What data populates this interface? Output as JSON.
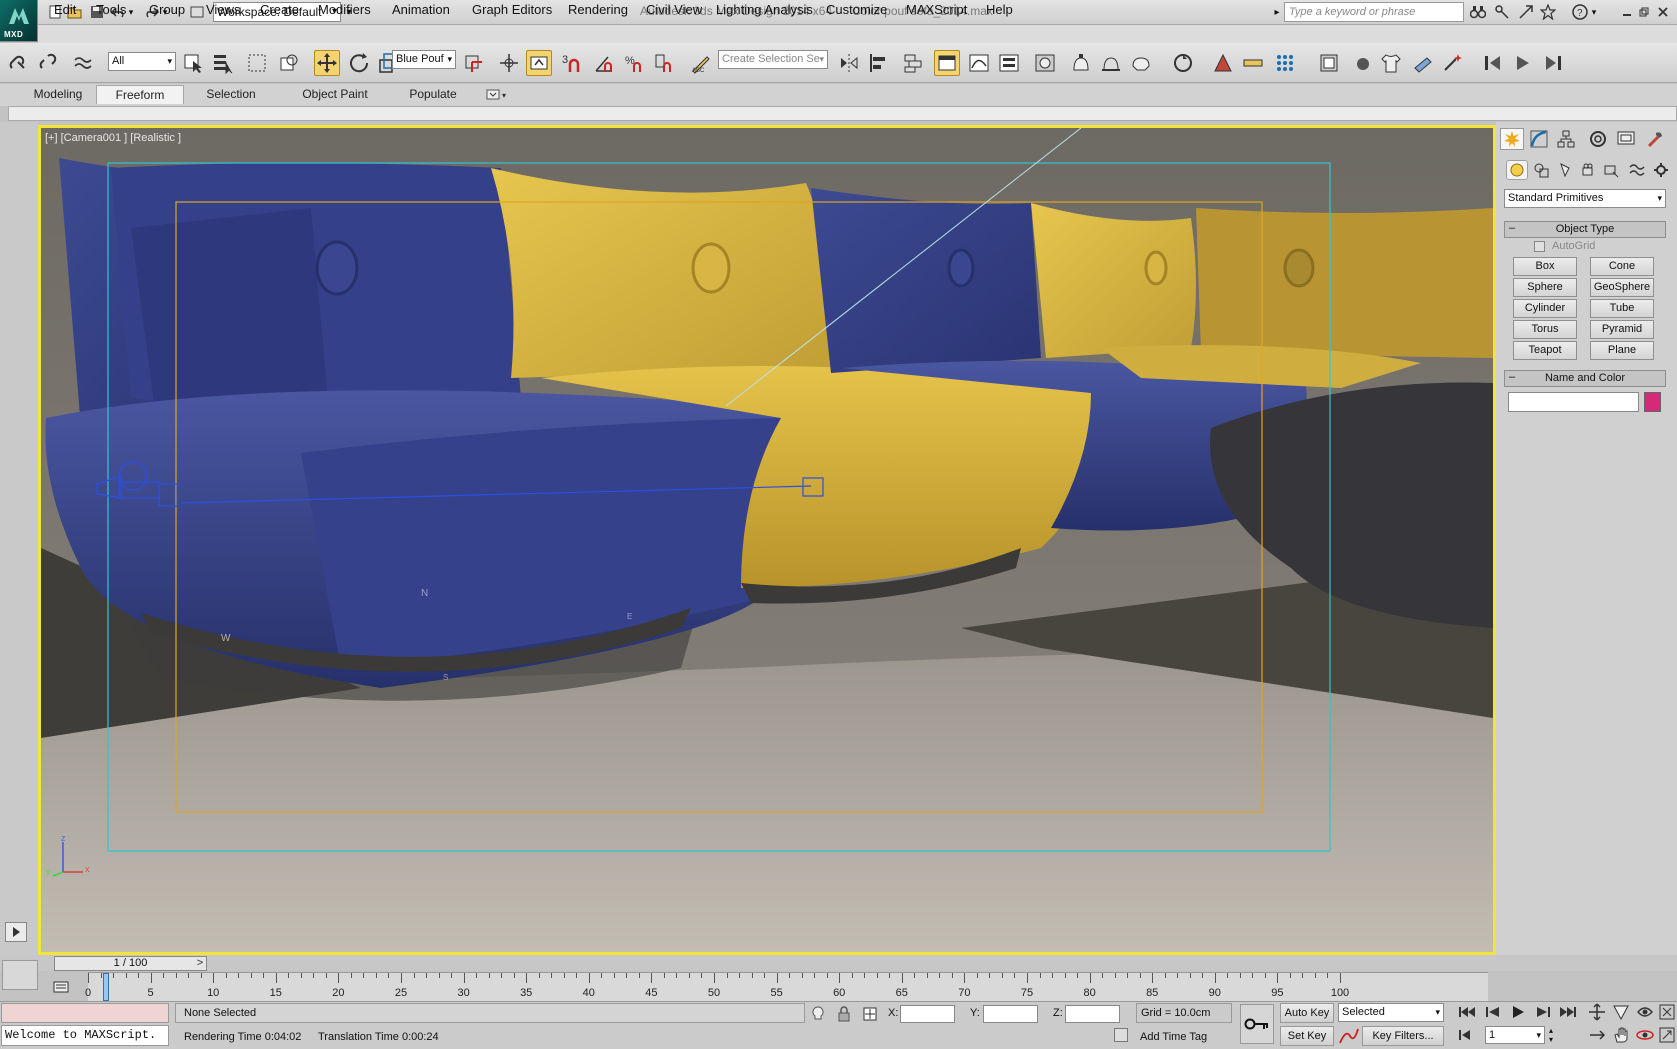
{
  "app": {
    "title": "Autodesk 3ds Max Design 2014 x64",
    "file": "Color pouf sofa_2014.max",
    "logo_text": "MXD",
    "workspace": "Workspace: Default",
    "search_placeholder": "Type a keyword or phrase"
  },
  "menu": [
    "Edit",
    "Tools",
    "Group",
    "Views",
    "Create",
    "Modifiers",
    "Animation",
    "Graph Editors",
    "Rendering",
    "Civil View",
    "Lighting Analysis",
    "Customize",
    "MAXScript",
    "Help"
  ],
  "toolbar": {
    "selection_filter": "All",
    "layer": "Blue Pouf",
    "named_selection_placeholder": "Create Selection Se",
    "snap_3": "3"
  },
  "ribbon": {
    "tabs": [
      "Modeling",
      "Freeform",
      "Selection",
      "Object Paint",
      "Populate"
    ],
    "active": "Freeform"
  },
  "viewport": {
    "label": "[+] [Camera001 ] [Realistic ]",
    "axis_x": "x",
    "axis_y": "y",
    "axis_z": "z",
    "marker_n": "N",
    "marker_w": "W",
    "marker_e": "E",
    "marker_s": "S",
    "border_color": "#f1e43a",
    "safe_frame_outer_color": "#2fc5d6",
    "safe_frame_inner_color": "#e0a424"
  },
  "command_panel": {
    "category": "Standard Primitives",
    "object_type_title": "Object Type",
    "autogrid": "AutoGrid",
    "primitives": [
      "Box",
      "Cone",
      "Sphere",
      "GeoSphere",
      "Cylinder",
      "Tube",
      "Torus",
      "Pyramid",
      "Teapot",
      "Plane"
    ],
    "name_color_title": "Name and Color",
    "object_color": "#d42a78"
  },
  "timeline": {
    "frame_display": "1 / 100",
    "prev": "<",
    "next": ">",
    "ticks": [
      "0",
      "5",
      "10",
      "15",
      "20",
      "25",
      "30",
      "35",
      "40",
      "45",
      "50",
      "55",
      "60",
      "65",
      "70",
      "75",
      "80",
      "85",
      "90",
      "95",
      "100"
    ]
  },
  "status": {
    "selection": "None Selected",
    "maxscript": "Welcome to MAXScript.",
    "rendering_time": "Rendering Time  0:04:02",
    "translation_time": "Translation Time  0:00:24",
    "x_label": "X:",
    "y_label": "Y:",
    "z_label": "Z:",
    "grid": "Grid = 10.0cm",
    "add_time_tag": "Add Time Tag",
    "auto_key": "Auto Key",
    "set_key": "Set Key",
    "key_mode": "Selected",
    "key_filters": "Key Filters...",
    "current_frame": "1"
  }
}
